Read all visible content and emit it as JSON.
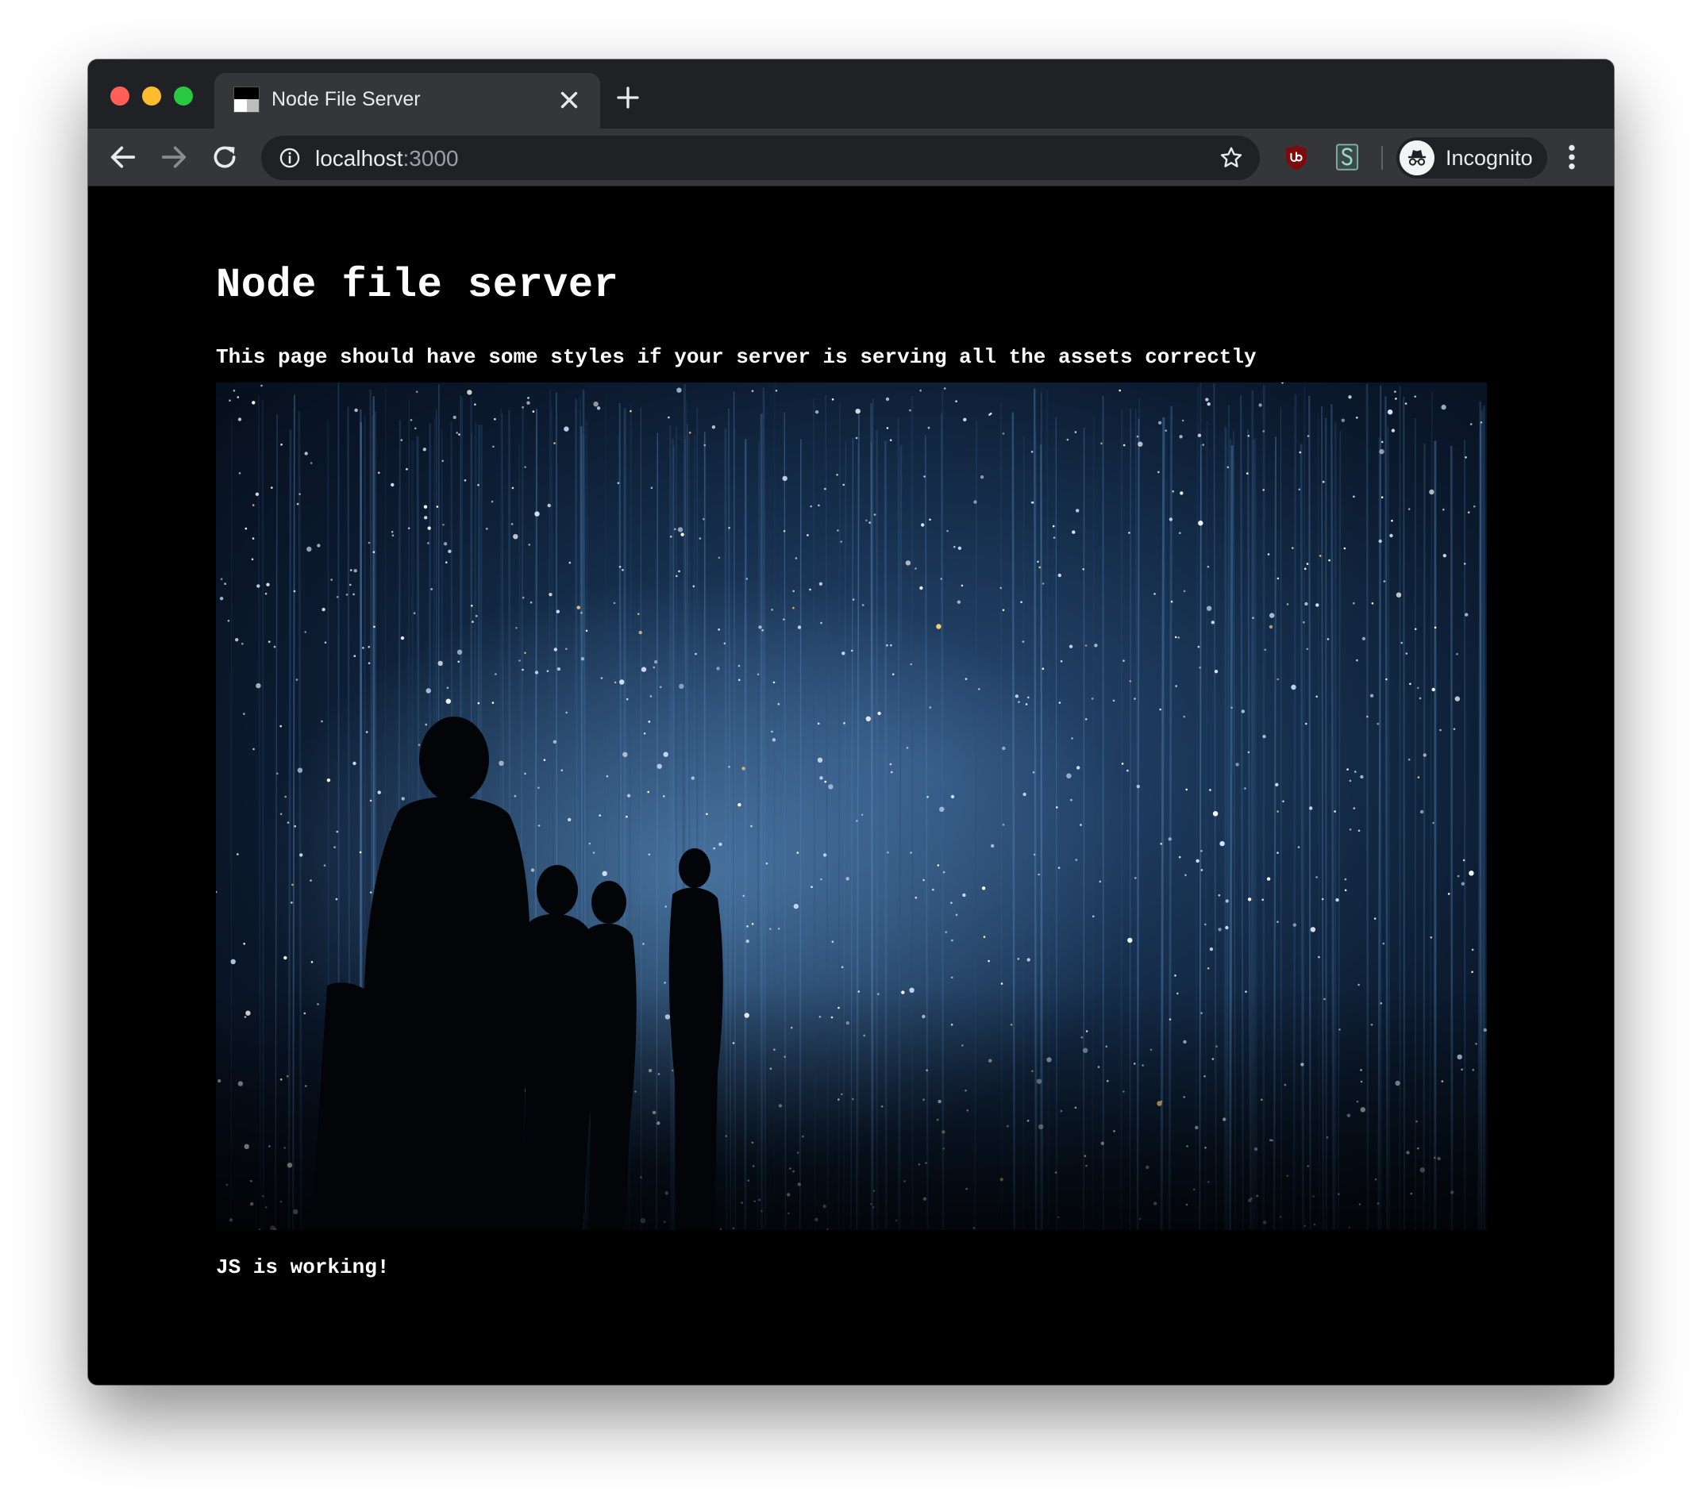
{
  "browser": {
    "tab": {
      "title": "Node File Server"
    },
    "address_bar": {
      "host": "localhost",
      "port": ":3000"
    },
    "profile": {
      "label": "Incognito"
    },
    "icons": {
      "close_window": "traffic-light-close",
      "minimize_window": "traffic-light-minimize",
      "maximize_window": "traffic-light-maximize",
      "tab_favicon": "page-favicon",
      "tab_close": "close-icon",
      "new_tab": "plus-icon",
      "back": "arrow-left-icon",
      "forward": "arrow-right-icon",
      "reload": "reload-icon",
      "site_info": "info-icon",
      "bookmark": "star-icon",
      "extension_1": "ublock-shield-icon",
      "extension_2": "s-extension-icon",
      "incognito": "incognito-icon",
      "menu": "kebab-menu-icon"
    },
    "colors": {
      "titlebar": "#202124",
      "toolbar": "#35363a",
      "omnibox": "#202124",
      "text": "#e8eaed",
      "muted_text": "#9aa0a6"
    }
  },
  "page": {
    "heading": "Node file server",
    "description": "This page should have some styles if your server is serving all the assets correctly",
    "image": {
      "subject": "people-silhouettes-among-hanging-light-strings"
    },
    "js_status": "JS is working!",
    "colors": {
      "background": "#000000",
      "text": "#ffffff"
    }
  }
}
